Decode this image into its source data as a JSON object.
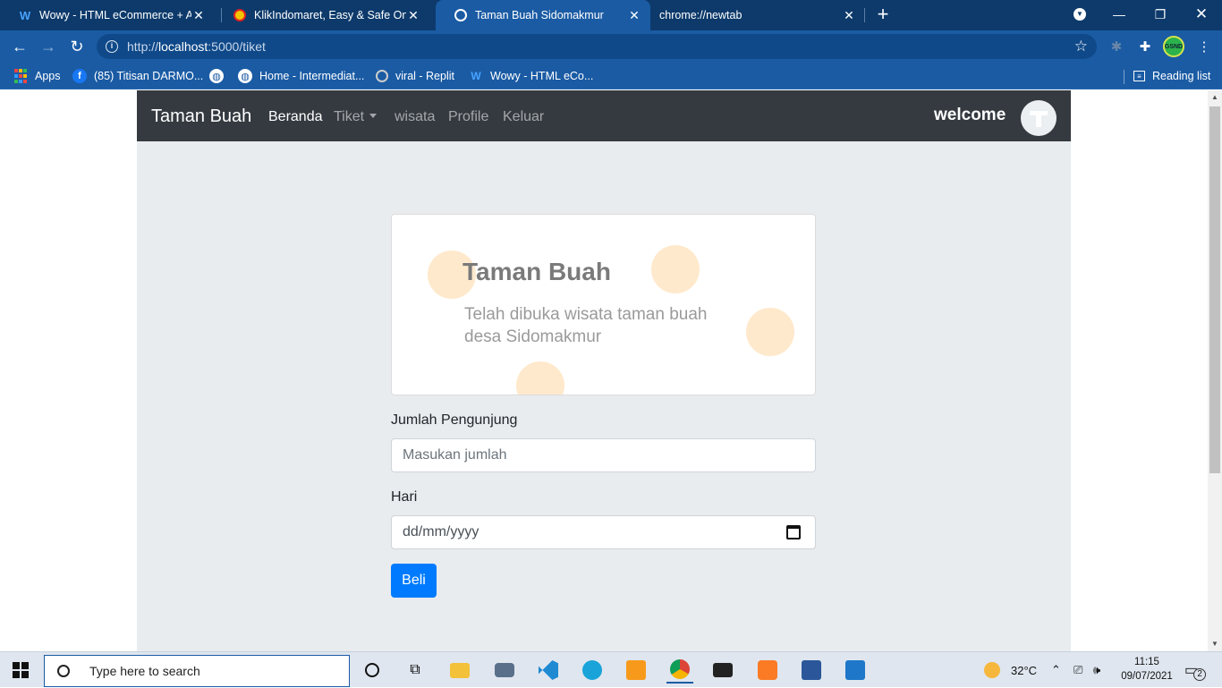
{
  "browser": {
    "tabs": [
      {
        "title": "Wowy - HTML eCommerce + Adm",
        "icon": "wowy-w-icon",
        "active": false
      },
      {
        "title": "KlikIndomaret, Easy & Safe Online",
        "icon": "klikindomaret-icon",
        "active": false
      },
      {
        "title": "Taman Buah Sidomakmur",
        "icon": "globe-icon",
        "active": true
      },
      {
        "title": "chrome://newtab",
        "icon": "",
        "active": false
      }
    ],
    "url_prefix": "http://",
    "url_host": "localhost",
    "url_path": ":5000/tiket",
    "bookmarks": [
      {
        "label": "Apps",
        "icon": "apps-grid-icon"
      },
      {
        "label": "(85) Titisan DARMO...",
        "icon": "facebook-icon"
      },
      {
        "label": "",
        "icon": "globe-icon"
      },
      {
        "label": "Home - Intermediat...",
        "icon": "globe-icon"
      },
      {
        "label": "viral - Replit",
        "icon": "replit-icon"
      },
      {
        "label": "Wowy - HTML eCo...",
        "icon": "wowy-w-icon"
      }
    ],
    "reading_list": "Reading list",
    "profile_badge": "GSND"
  },
  "page": {
    "brand": "Taman Buah",
    "nav": {
      "beranda": "Beranda",
      "tiket": "Tiket",
      "wisata": "wisata",
      "profile": "Profile",
      "keluar": "Keluar"
    },
    "welcome": "welcome",
    "banner": {
      "title": "Taman Buah",
      "subtitle": "Telah dibuka wisata taman buah desa Sidomakmur"
    },
    "form": {
      "jumlah_label": "Jumlah Pengunjung",
      "jumlah_placeholder": "Masukan jumlah",
      "hari_label": "Hari",
      "hari_placeholder": "dd/mm/yyyy",
      "submit": "Beli"
    }
  },
  "taskbar": {
    "search_placeholder": "Type here to search",
    "weather": "32°C",
    "time": "11:15",
    "date": "09/07/2021",
    "notifications": "2"
  },
  "colors": {
    "browser_frame": "#1a5ba4",
    "navbar": "#343a40",
    "page_bg": "#e9ecef",
    "primary_button": "#007bff",
    "banner_dot": "#ffe9cc"
  }
}
